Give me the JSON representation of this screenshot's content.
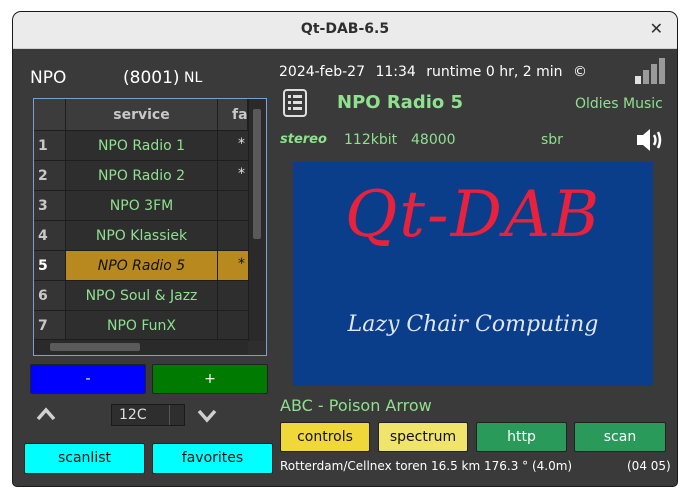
{
  "window": {
    "title": "Qt-DAB-6.5"
  },
  "ensemble": {
    "name": "NPO",
    "id": "(8001)",
    "country": "NL"
  },
  "status": {
    "date": "2024-feb-27",
    "time": "11:34",
    "runtime": "runtime 0 hr, 2 min",
    "copyright": "©"
  },
  "service": {
    "name": "NPO Radio 5",
    "program_type": "Oldies Music",
    "mode": "stereo",
    "bitrate": "112kbit",
    "samplerate": "48000",
    "sbr": "sbr",
    "dynamic_label": "ABC - Poison Arrow"
  },
  "slide": {
    "title": "Qt-DAB",
    "subtitle": "Lazy Chair Computing",
    "background": "#0a3d8a",
    "title_color": "#e8223c"
  },
  "table": {
    "headers": [
      "service",
      "fav"
    ],
    "rows": [
      {
        "num": "1",
        "service": "NPO Radio 1",
        "fav": "*"
      },
      {
        "num": "2",
        "service": "NPO Radio 2",
        "fav": "*"
      },
      {
        "num": "3",
        "service": "NPO 3FM",
        "fav": ""
      },
      {
        "num": "4",
        "service": "NPO Klassiek",
        "fav": ""
      },
      {
        "num": "5",
        "service": "NPO Radio 5",
        "fav": "*"
      },
      {
        "num": "6",
        "service": "NPO Soul & Jazz",
        "fav": ""
      },
      {
        "num": "7",
        "service": "NPO FunX",
        "fav": ""
      }
    ],
    "selected_row": 4
  },
  "controls": {
    "minus": "-",
    "plus": "+",
    "channel": "12C",
    "scanlist": "scanlist",
    "favorites": "favorites",
    "controls": "controls",
    "spectrum": "spectrum",
    "http": "http",
    "scan": "scan"
  },
  "transmitter": {
    "info": "Rotterdam/Cellnex toren 16.5 km 176.3 °  (4.0m)",
    "code": "(04 05)"
  },
  "colors": {
    "minus_bg": "#0000ff",
    "plus_bg": "#007a00",
    "cyan": "#00ffff",
    "yellow": "#f0d83a",
    "green_btn": "#2a9a5a",
    "selected": "#b8891f"
  }
}
